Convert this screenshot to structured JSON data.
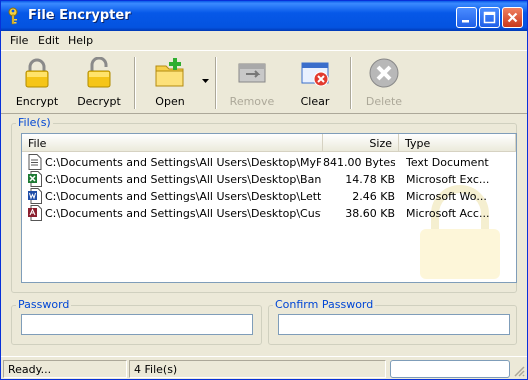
{
  "window": {
    "title": "File Encrypter",
    "title_icon": "key-icon",
    "controls": [
      "minimize-icon",
      "maximize-icon",
      "close-icon"
    ]
  },
  "menu": {
    "items": [
      "File",
      "Edit",
      "Help"
    ]
  },
  "toolbar": {
    "buttons": [
      {
        "label": "Encrypt",
        "icon": "locked-padlock-icon",
        "enabled": true
      },
      {
        "label": "Decrypt",
        "icon": "unlocked-padlock-icon",
        "enabled": true
      },
      {
        "label": "Open",
        "icon": "folder-add-icon",
        "enabled": true,
        "has_dropdown": true
      },
      {
        "label": "Remove",
        "icon": "remove-file-icon",
        "enabled": false
      },
      {
        "label": "Clear",
        "icon": "clear-list-icon",
        "enabled": true
      },
      {
        "label": "Delete",
        "icon": "delete-x-icon",
        "enabled": false
      }
    ]
  },
  "files_group": {
    "title": "File(s)",
    "columns": [
      "File",
      "Size",
      "Type"
    ],
    "rows": [
      {
        "file": "C:\\Documents and Settings\\All Users\\Desktop\\MyFile.txt",
        "size": "841.00 Bytes",
        "type": "Text Document",
        "icon": "text-file-icon"
      },
      {
        "file": "C:\\Documents and Settings\\All Users\\Desktop\\Bank Det...",
        "size": "14.78 KB",
        "type": "Microsoft Exc...",
        "icon": "excel-file-icon"
      },
      {
        "file": "C:\\Documents and Settings\\All Users\\Desktop\\Letter.doc",
        "size": "2.46 KB",
        "type": "Microsoft Wo...",
        "icon": "word-file-icon"
      },
      {
        "file": "C:\\Documents and Settings\\All Users\\Desktop\\Custome...",
        "size": "38.60 KB",
        "type": "Microsoft Acc...",
        "icon": "access-file-icon"
      }
    ]
  },
  "password": {
    "label": "Password",
    "value": ""
  },
  "confirm_password": {
    "label": "Confirm Password",
    "value": ""
  },
  "status": {
    "text": "Ready...",
    "count": "4 File(s)",
    "progress": 0
  }
}
